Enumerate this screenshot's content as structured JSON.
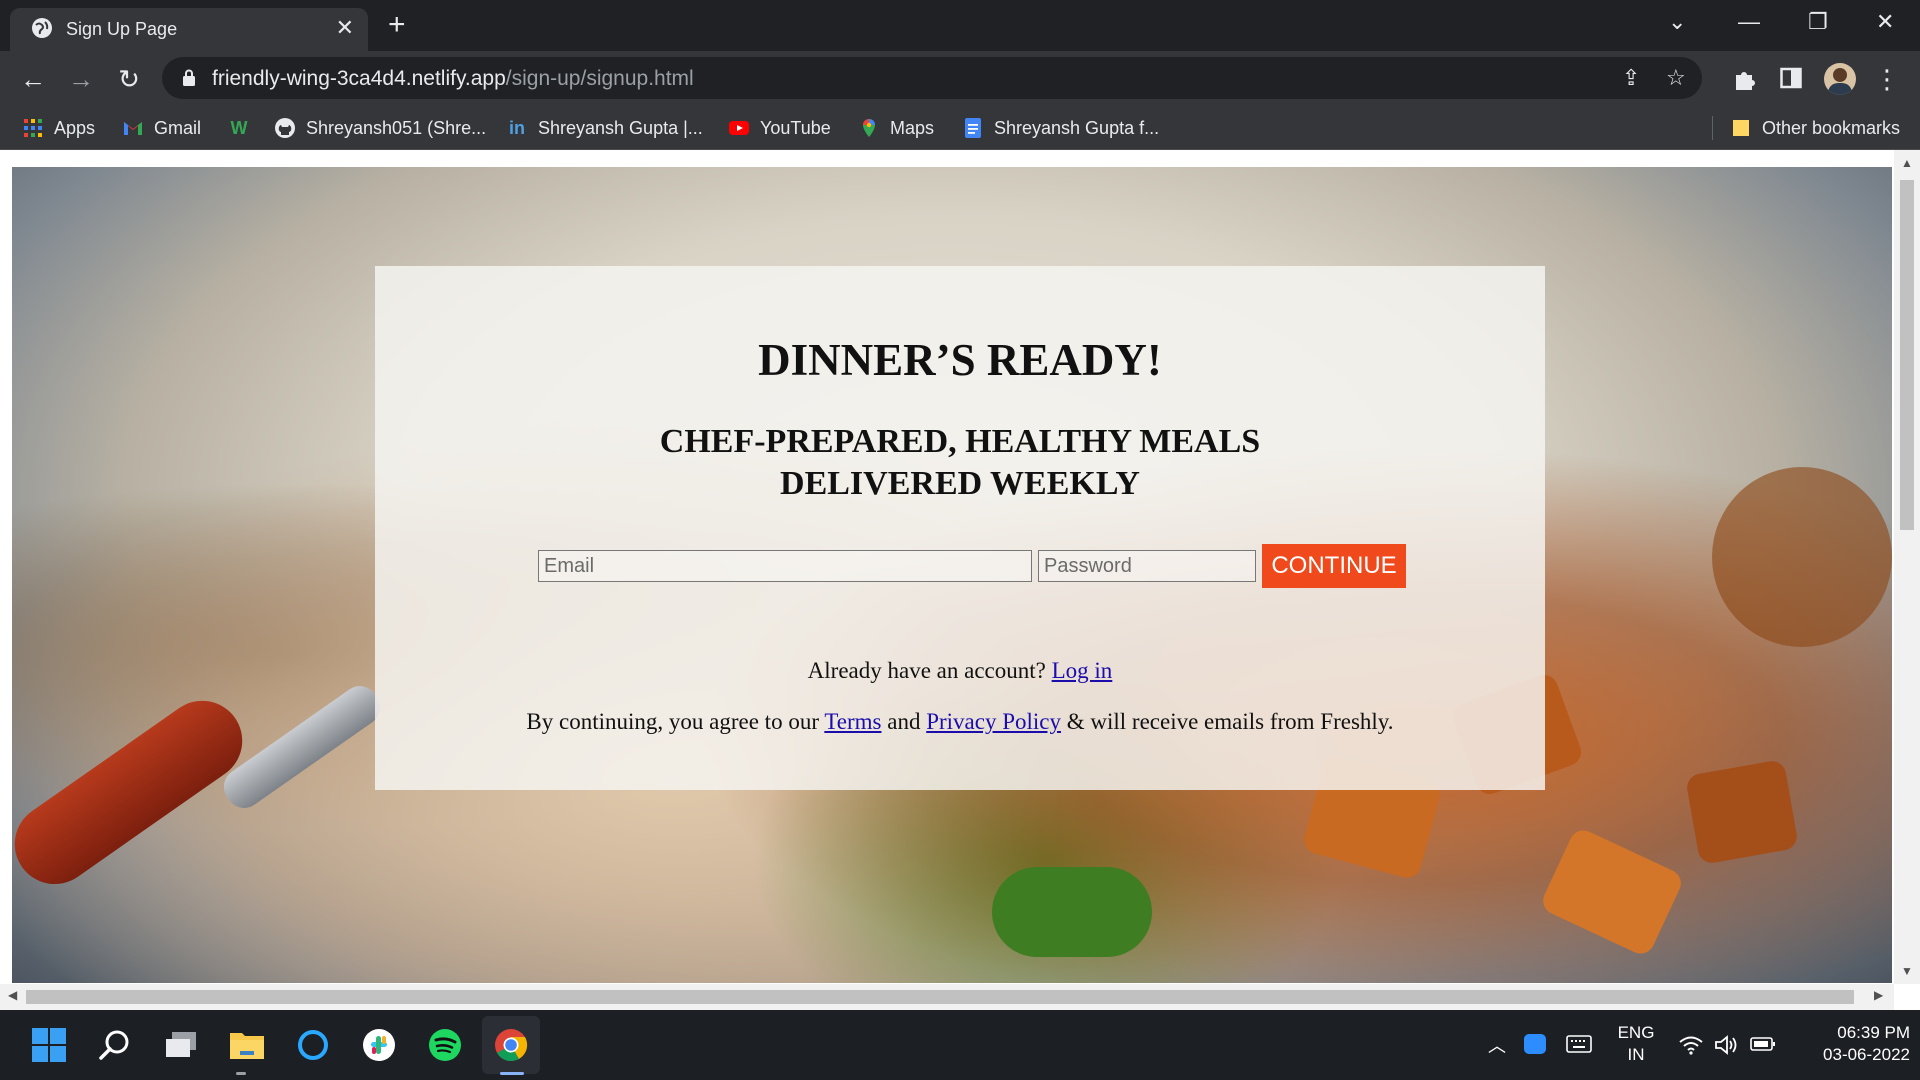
{
  "browser": {
    "tab_title": "Sign Up Page",
    "url_host": "friendly-wing-3ca4d4.netlify.app",
    "url_path": "/sign-up/signup.html"
  },
  "bookmarks": {
    "apps": "Apps",
    "gmail": "Gmail",
    "github": "Shreyansh051 (Shre...",
    "linkedin": "Shreyansh Gupta |...",
    "youtube": "YouTube",
    "maps": "Maps",
    "docs": "Shreyansh Gupta f...",
    "other": "Other bookmarks"
  },
  "page": {
    "heading": "DINNER’S READY!",
    "subheading_line1": "CHEF-PREPARED, HEALTHY MEALS",
    "subheading_line2": "DELIVERED WEEKLY",
    "email_placeholder": "Email",
    "password_placeholder": "Password",
    "continue_label": "CONTINUE",
    "already_text": "Already have an account?",
    "login_link": "Log in",
    "terms_prefix": "By continuing, you agree to our",
    "terms_link": "Terms",
    "and_text": "and",
    "privacy_link": "Privacy Policy",
    "terms_suffix": "& will receive emails from Freshly."
  },
  "taskbar": {
    "lang_line1": "ENG",
    "lang_line2": "IN",
    "time": "06:39 PM",
    "date": "03-06-2022"
  },
  "colors": {
    "continue_button": "#f0491c",
    "link": "#1a0dab",
    "chrome_dark": "#202124",
    "chrome_toolbar": "#35363a"
  }
}
